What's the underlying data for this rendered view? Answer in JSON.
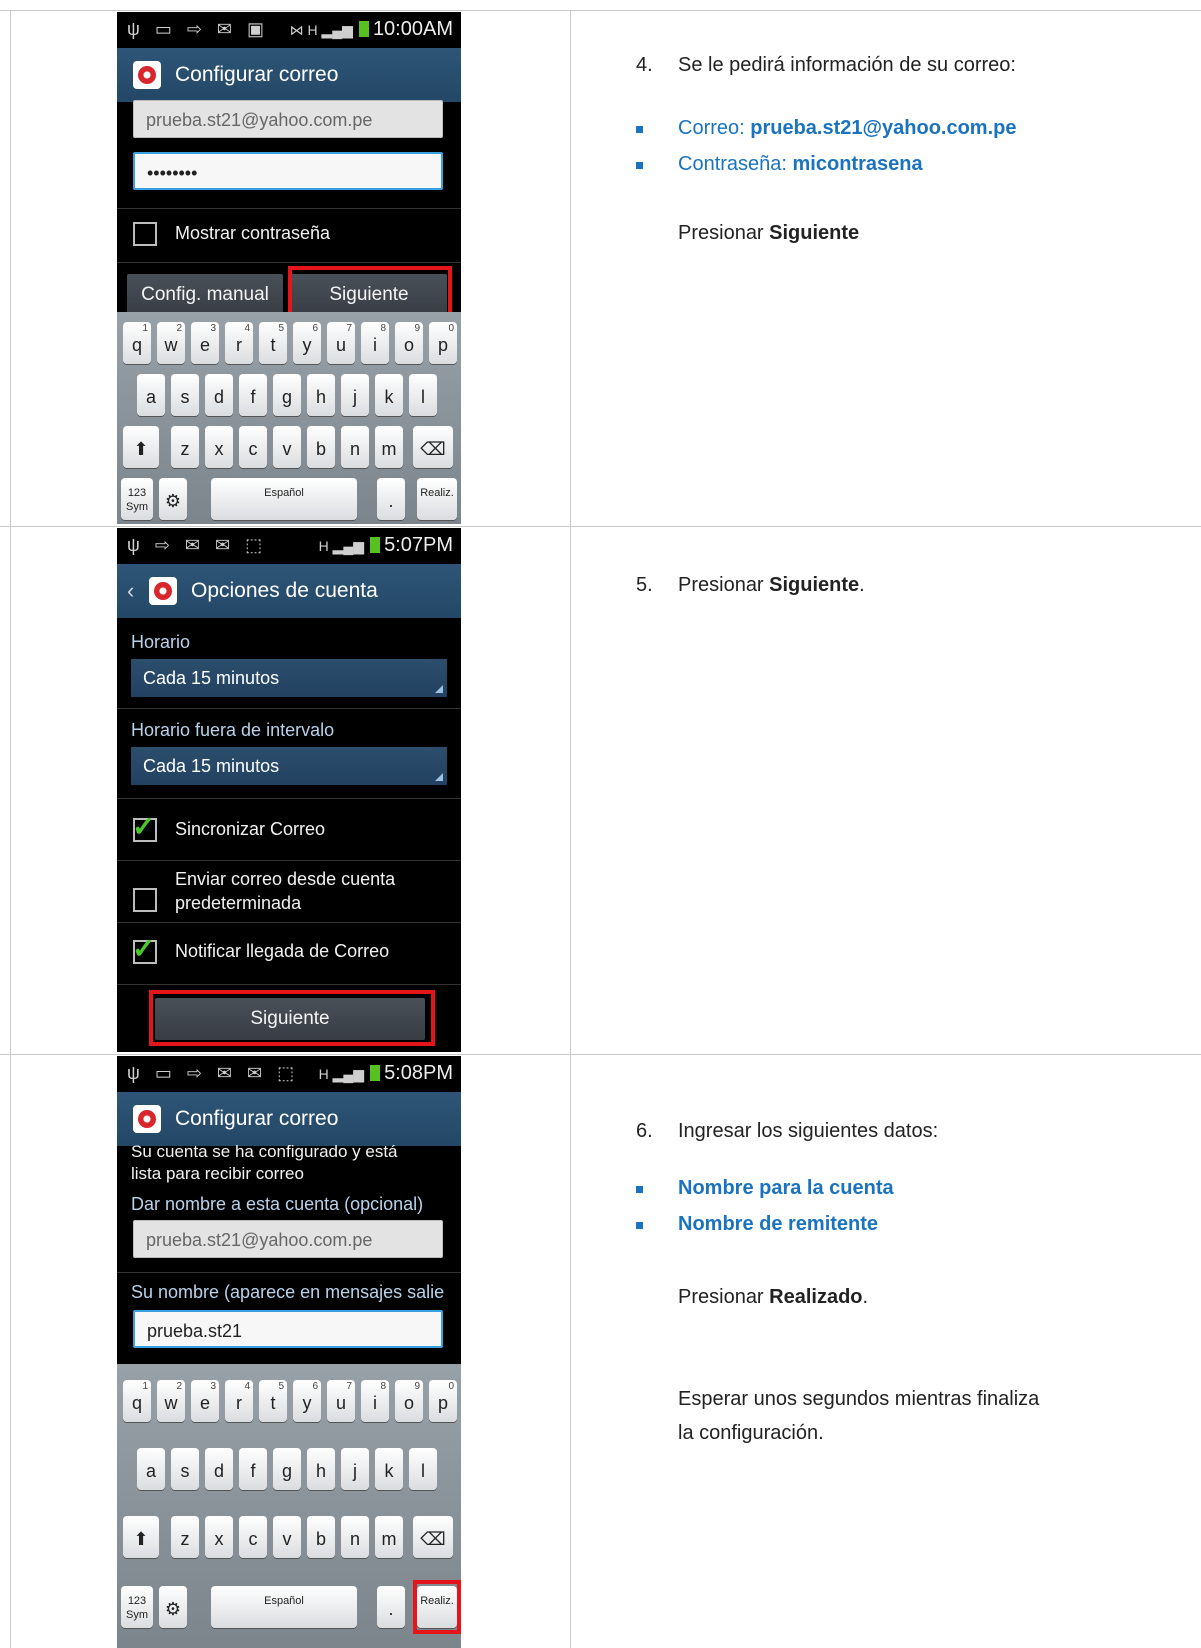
{
  "step4": {
    "status_time": "10:00AM",
    "app_title": "Configurar correo",
    "email_value": "prueba.st21@yahoo.com.pe",
    "password_value": "••••••••",
    "show_password_label": "Mostrar contraseña",
    "manual_button": "Config. manual",
    "next_button": "Siguiente",
    "instruction_number": "4.",
    "instruction": "Se le pedirá información de su correo:",
    "bullet1_label": "Correo: ",
    "bullet1_value": "prueba.st21@yahoo.com.pe",
    "bullet2_label": "Contraseña: ",
    "bullet2_value": "micontrasena",
    "press_prefix": "Presionar ",
    "press_value": "Siguiente"
  },
  "step5": {
    "status_time": "5:07PM",
    "app_title": "Opciones de cuenta",
    "schedule_label": "Horario",
    "schedule_value": "Cada 15 minutos",
    "offpeak_label": "Horario fuera de intervalo",
    "offpeak_value": "Cada 15 minutos",
    "sync_label": "Sincronizar Correo",
    "default_label_1": "Enviar correo desde cuenta",
    "default_label_2": "predeterminada",
    "notify_label": "Notificar llegada de Correo",
    "next_button": "Siguiente",
    "instruction_number": "5.",
    "press_prefix": "Presionar ",
    "press_value": "Siguiente",
    "press_suffix": "."
  },
  "step6": {
    "status_time": "5:08PM",
    "app_title": "Configurar correo",
    "info_line1": "Su cuenta se ha configurado y está",
    "info_line2": "lista para recibir correo",
    "account_name_label": "Dar nombre a esta cuenta (opcional)",
    "account_name_value": "prueba.st21@yahoo.com.pe",
    "your_name_label": "Su nombre (aparece en mensajes salie",
    "your_name_value": "prueba.st21",
    "instruction_number": "6.",
    "instruction": "Ingresar los siguientes datos:",
    "bullet1": "Nombre para la cuenta",
    "bullet2": "Nombre de remitente",
    "press_prefix": "Presionar ",
    "press_value": "Realizado",
    "press_suffix": ".",
    "wait_line1": "Esperar unos segundos mientras finaliza",
    "wait_line2": "la configuración."
  },
  "keyboard": {
    "row1": [
      "q",
      "w",
      "e",
      "r",
      "t",
      "y",
      "u",
      "i",
      "o",
      "p"
    ],
    "row1_nums": [
      "1",
      "2",
      "3",
      "4",
      "5",
      "6",
      "7",
      "8",
      "9",
      "0"
    ],
    "row2": [
      "a",
      "s",
      "d",
      "f",
      "g",
      "h",
      "j",
      "k",
      "l"
    ],
    "row3": [
      "z",
      "x",
      "c",
      "v",
      "b",
      "n",
      "m"
    ],
    "sym_key": "123 Sym",
    "space_label": "Español",
    "done_key": "Realiz."
  },
  "icons": [
    "usb-icon",
    "keyboard-icon",
    "sync-icon",
    "mail-icon",
    "image-icon",
    "signal-icon",
    "battery-icon",
    "shift-icon",
    "backspace-icon",
    "gear-icon",
    "email-app-icon",
    "back-chevron-icon"
  ],
  "colors": {
    "accent_blue": "#1a73c0",
    "highlight_red": "#e4161c",
    "check_green": "#4ac82a"
  }
}
